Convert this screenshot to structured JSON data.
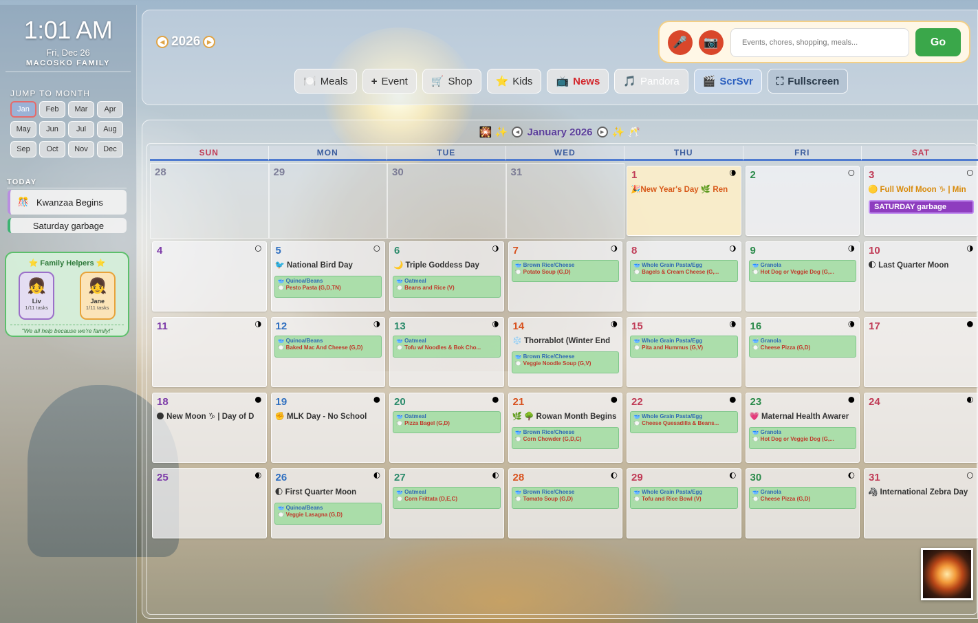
{
  "sidebar": {
    "time": "1:01 AM",
    "date": "Fri, Dec 26",
    "family": "MACOSKO FAMILY",
    "jump_label": "JUMP TO MONTH",
    "months": [
      "Jan",
      "Feb",
      "Mar",
      "Apr",
      "May",
      "Jun",
      "Jul",
      "Aug",
      "Sep",
      "Oct",
      "Nov",
      "Dec"
    ],
    "active_month": "Jan",
    "today_label": "TODAY",
    "today_events": [
      {
        "icon": "🎊",
        "label": "Kwanzaa Begins"
      }
    ],
    "today_chore": "Saturday garbage",
    "helpers": {
      "title": "⭐ Family Helpers ⭐",
      "people": [
        {
          "name": "Liv",
          "tasks": "1/11 tasks",
          "icon": "👧"
        },
        {
          "name": "Jane",
          "tasks": "1/11 tasks",
          "icon": "👧"
        }
      ],
      "footer": "\"We all help because we're family!\""
    }
  },
  "header": {
    "year": "2026",
    "prev_icon": "◀",
    "next_icon": "▶",
    "search_placeholder": "Events, chores, shopping, meals...",
    "go_label": "Go",
    "mic_icon": "🎤",
    "camera_icon": "📷",
    "toolbar": [
      {
        "icon": "🍽️",
        "label": "Meals"
      },
      {
        "icon": "+",
        "label": "Event"
      },
      {
        "icon": "🛒",
        "label": "Shop"
      },
      {
        "icon": "⭐",
        "label": "Kids"
      },
      {
        "icon": "📺",
        "label": "News"
      },
      {
        "icon": "🎵",
        "label": "Pandora"
      },
      {
        "icon": "🎬",
        "label": "ScrSvr"
      },
      {
        "icon": "⛶",
        "label": "Fullscreen"
      }
    ]
  },
  "calendar": {
    "title": "January 2026",
    "title_left_deco": "🎇 ✨",
    "title_right_deco": "✨ 🥂",
    "days_of_week": [
      "SUN",
      "MON",
      "TUE",
      "WED",
      "THU",
      "FRI",
      "SAT"
    ],
    "weeks": [
      [
        {
          "day": "28",
          "other": true
        },
        {
          "day": "29",
          "other": true
        },
        {
          "day": "30",
          "other": true
        },
        {
          "day": "31",
          "other": true
        },
        {
          "day": "1",
          "moon": "🌘",
          "event": "🎉New Year's Day 🌿 Ren",
          "style": "today1"
        },
        {
          "day": "2",
          "moon": "🌕"
        },
        {
          "day": "3",
          "moon": "🌕",
          "event": "🟡 Full Wolf Moon ♑ | Min",
          "chore": "SATURDAY garbage"
        }
      ],
      [
        {
          "day": "4",
          "moon": "🌕"
        },
        {
          "day": "5",
          "moon": "🌕",
          "event": "🐦 National Bird Day",
          "meal": {
            "b": "🥣 Quinoa/Beans",
            "l": "🍽️ Pesto Pasta (G,D,TN)"
          }
        },
        {
          "day": "6",
          "moon": "🌖",
          "event": "🌙 Triple Goddess Day",
          "meal": {
            "b": "🥣 Oatmeal",
            "l": "🍽️ Beans and Rice (V)"
          }
        },
        {
          "day": "7",
          "moon": "🌖",
          "meal": {
            "b": "🥣 Brown Rice/Cheese",
            "l": "🍽️ Potato Soup (G,D)"
          }
        },
        {
          "day": "8",
          "moon": "🌖",
          "meal": {
            "b": "🥣 Whole Grain Pasta/Egg",
            "l": "🍽️ Bagels & Cream Cheese (G,..."
          }
        },
        {
          "day": "9",
          "moon": "🌗",
          "meal": {
            "b": "🥣 Granola",
            "l": "🍽️ Hot Dog or Veggie Dog (G,..."
          }
        },
        {
          "day": "10",
          "moon": "🌗",
          "event": "🌓 Last Quarter Moon"
        }
      ],
      [
        {
          "day": "11",
          "moon": "🌗"
        },
        {
          "day": "12",
          "moon": "🌗",
          "meal": {
            "b": "🥣 Quinoa/Beans",
            "l": "🍽️ Baked Mac And Cheese (G,D)"
          }
        },
        {
          "day": "13",
          "moon": "🌘",
          "meal": {
            "b": "🥣 Oatmeal",
            "l": "🍽️ Tofu w/ Noodles & Bok Cho..."
          }
        },
        {
          "day": "14",
          "moon": "🌘",
          "event": "❄️ Thorrablot (Winter End",
          "meal": {
            "b": "🥣 Brown Rice/Cheese",
            "l": "🍽️ Veggie Noodle Soup (G,V)"
          },
          "meal_low": true
        },
        {
          "day": "15",
          "moon": "🌘",
          "meal": {
            "b": "🥣 Whole Grain Pasta/Egg",
            "l": "🍽️ Pita and Hummus (G,V)"
          }
        },
        {
          "day": "16",
          "moon": "🌘",
          "meal": {
            "b": "🥣 Granola",
            "l": "🍽️ Cheese Pizza (G,D)"
          }
        },
        {
          "day": "17",
          "moon": "🌑"
        }
      ],
      [
        {
          "day": "18",
          "moon": "🌑",
          "event": "🌑 New Moon ♑ | Day of D"
        },
        {
          "day": "19",
          "moon": "🌑",
          "event": "✊ MLK Day - No School"
        },
        {
          "day": "20",
          "moon": "🌑",
          "meal": {
            "b": "🥣 Oatmeal",
            "l": "🍽️ Pizza Bagel (G,D)"
          }
        },
        {
          "day": "21",
          "moon": "🌑",
          "event": "🌿 🌳 Rowan Month Begins",
          "meal": {
            "b": "🥣 Brown Rice/Cheese",
            "l": "🍽️ Corn Chowder (G,D,C)"
          },
          "meal_low": true
        },
        {
          "day": "22",
          "moon": "🌑",
          "meal": {
            "b": "🥣 Whole Grain Pasta/Egg",
            "l": "🍽️ Cheese Quesadilla & Beans..."
          }
        },
        {
          "day": "23",
          "moon": "🌑",
          "event": "💗 Maternal Health Awarer",
          "meal": {
            "b": "🥣 Granola",
            "l": "🍽️ Hot Dog or Veggie Dog (G,..."
          },
          "meal_low": true
        },
        {
          "day": "24",
          "moon": "🌒"
        }
      ],
      [
        {
          "day": "25",
          "moon": "🌒"
        },
        {
          "day": "26",
          "moon": "🌓",
          "event": "🌓 First Quarter Moon",
          "meal": {
            "b": "🥣 Quinoa/Beans",
            "l": "🍽️ Veggie Lasagna (G,D)"
          },
          "meal_low": true
        },
        {
          "day": "27",
          "moon": "🌓",
          "meal": {
            "b": "🥣 Oatmeal",
            "l": "🍽️ Corn Frittata (D,E,C)"
          }
        },
        {
          "day": "28",
          "moon": "🌔",
          "meal": {
            "b": "🥣 Brown Rice/Cheese",
            "l": "🍽️ Tomato Soup (G,D)"
          }
        },
        {
          "day": "29",
          "moon": "🌔",
          "meal": {
            "b": "🥣 Whole Grain Pasta/Egg",
            "l": "🍽️ Tofu and Rice Bowl (V)"
          }
        },
        {
          "day": "30",
          "moon": "🌔",
          "meal": {
            "b": "🥣 Granola",
            "l": "🍽️ Cheese Pizza (G,D)"
          }
        },
        {
          "day": "31",
          "moon": "🌕",
          "event": "🦓 International Zebra Day"
        }
      ]
    ],
    "day_colors": {
      "sun": "#7c3aa8",
      "mon": "#2f6fc0",
      "tue": "#2a8a6a",
      "wed": "#d8521f",
      "thu": "#c03b56",
      "fri": "#2a8a4a",
      "sat": "#c03b56"
    }
  }
}
